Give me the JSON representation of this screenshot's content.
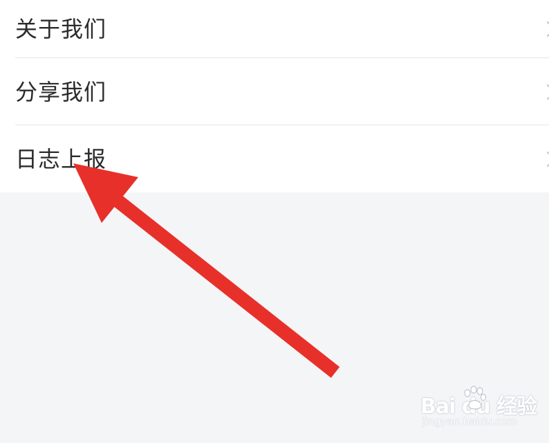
{
  "menu": {
    "items": [
      {
        "label": "关于我们",
        "chevron_icon": "chevron-right-icon"
      },
      {
        "label": "分享我们",
        "chevron_icon": "chevron-right-icon"
      },
      {
        "label": "日志上报",
        "chevron_icon": "chevron-right-icon"
      }
    ]
  },
  "annotation": {
    "arrow_icon": "red-arrow-icon",
    "arrow_color": "#e8302a",
    "points_to": "日志上报"
  },
  "watermark": {
    "brand": "Bai du 经验",
    "url": "jingyan.baidu.com"
  },
  "colors": {
    "background": "#f4f5f7",
    "list_background": "#ffffff",
    "divider": "#e6e6e6",
    "text": "#2b2b2b"
  }
}
